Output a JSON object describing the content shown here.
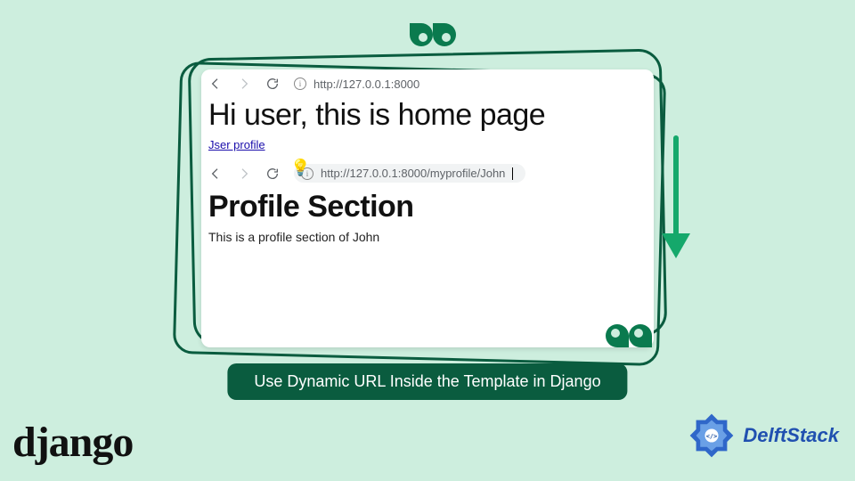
{
  "caption": "Use Dynamic URL Inside the Template in Django",
  "logos": {
    "django": "django",
    "delftstack": "DelftStack"
  },
  "panel1": {
    "url": "http://127.0.0.1:8000",
    "heading": "Hi user, this is home page",
    "link_text": "Jser profile"
  },
  "panel2": {
    "url": "http://127.0.0.1:8000/myprofile/John",
    "heading": "Profile Section",
    "body": "This is a profile section of John"
  }
}
